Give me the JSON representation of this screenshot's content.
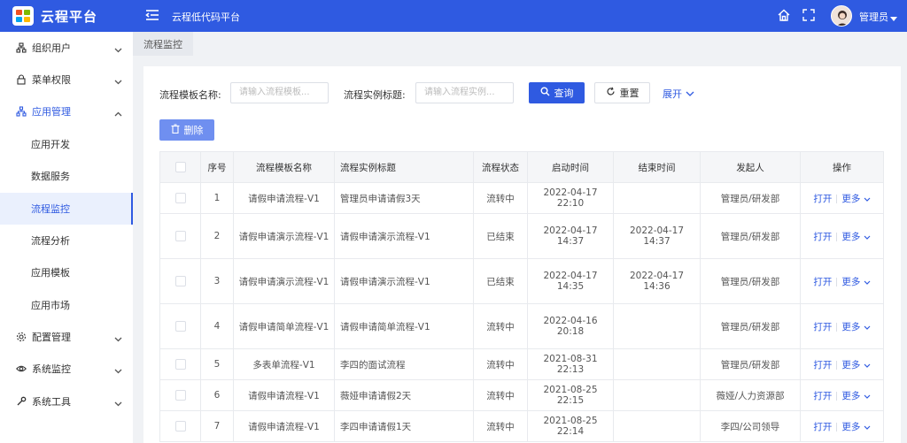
{
  "header": {
    "app_title": "云程平台",
    "sub_title": "云程低代码平台",
    "user_name": "管理员",
    "brand_color": "#2f5ae1"
  },
  "sidebar": {
    "items": [
      {
        "label": "组织用户",
        "icon": "org-icon",
        "chevron": "down"
      },
      {
        "label": "菜单权限",
        "icon": "lock-icon",
        "chevron": "down"
      },
      {
        "label": "应用管理",
        "icon": "app-tree-icon",
        "chevron": "up"
      },
      {
        "label": "应用开发"
      },
      {
        "label": "数据服务"
      },
      {
        "label": "流程监控"
      },
      {
        "label": "流程分析"
      },
      {
        "label": "应用模板"
      },
      {
        "label": "应用市场"
      },
      {
        "label": "配置管理",
        "icon": "gear-icon",
        "chevron": "down"
      },
      {
        "label": "系统监控",
        "icon": "eye-icon",
        "chevron": "down"
      },
      {
        "label": "系统工具",
        "icon": "wrench-icon",
        "chevron": "down"
      }
    ]
  },
  "tab": {
    "label": "流程监控"
  },
  "filters": {
    "template_label": "流程模板名称:",
    "template_placeholder": "请输入流程模板...",
    "instance_label": "流程实例标题:",
    "instance_placeholder": "请输入流程实例...",
    "query_label": "查询",
    "reset_label": "重置",
    "expand_label": "展开"
  },
  "actions": {
    "delete_label": "删除"
  },
  "table": {
    "headers": [
      "序号",
      "流程模板名称",
      "流程实例标题",
      "流程状态",
      "启动时间",
      "结束时间",
      "发起人",
      "操作"
    ],
    "open_label": "打开",
    "more_label": "更多",
    "rows": [
      {
        "no": "1",
        "template": "请假申请流程-V1",
        "title": "管理员申请请假3天",
        "status": "流转中",
        "start": "2022-04-17 22:10",
        "end": "",
        "initiator": "管理员/研发部"
      },
      {
        "no": "2",
        "template": "请假申请演示流程-V1",
        "title": "请假申请演示流程-V1",
        "status": "已结束",
        "start": "2022-04-17 14:37",
        "end": "2022-04-17 14:37",
        "initiator": "管理员/研发部"
      },
      {
        "no": "3",
        "template": "请假申请演示流程-V1",
        "title": "请假申请演示流程-V1",
        "status": "已结束",
        "start": "2022-04-17 14:35",
        "end": "2022-04-17 14:36",
        "initiator": "管理员/研发部"
      },
      {
        "no": "4",
        "template": "请假申请简单流程-V1",
        "title": "请假申请简单流程-V1",
        "status": "流转中",
        "start": "2022-04-16 20:18",
        "end": "",
        "initiator": "管理员/研发部"
      },
      {
        "no": "5",
        "template": "多表单流程-V1",
        "title": "李四的面试流程",
        "status": "流转中",
        "start": "2021-08-31 22:13",
        "end": "",
        "initiator": "管理员/研发部"
      },
      {
        "no": "6",
        "template": "请假申请流程-V1",
        "title": "薇娅申请请假2天",
        "status": "流转中",
        "start": "2021-08-25 22:15",
        "end": "",
        "initiator": "薇娅/人力资源部"
      },
      {
        "no": "7",
        "template": "请假申请流程-V1",
        "title": "李四申请请假1天",
        "status": "流转中",
        "start": "2021-08-25 22:14",
        "end": "",
        "initiator": "李四/公司领导"
      }
    ]
  }
}
